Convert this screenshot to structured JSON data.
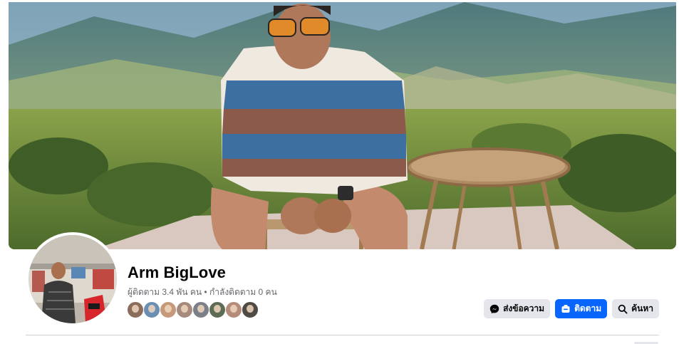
{
  "profile": {
    "name": "Arm BigLove",
    "stats": "ผู้ติดตาม 3.4 พัน คน • กำลังติดตาม 0 คน",
    "follower_avatar_colors": [
      "#8a6d5a",
      "#6b8fb3",
      "#c49a7a",
      "#a58a7d",
      "#7b7f88",
      "#5e6b55",
      "#b58b7a",
      "#4f4a44"
    ]
  },
  "actions": {
    "message_label": "ส่งข้อความ",
    "follow_label": "ติดตาม",
    "search_label": "ค้นหา"
  },
  "colors": {
    "primary": "#0866ff",
    "secondary_button": "#e4e6eb",
    "text_secondary": "#65676b"
  },
  "icons": {
    "message": "messenger-icon",
    "follow": "follow-icon",
    "search": "search-icon"
  }
}
